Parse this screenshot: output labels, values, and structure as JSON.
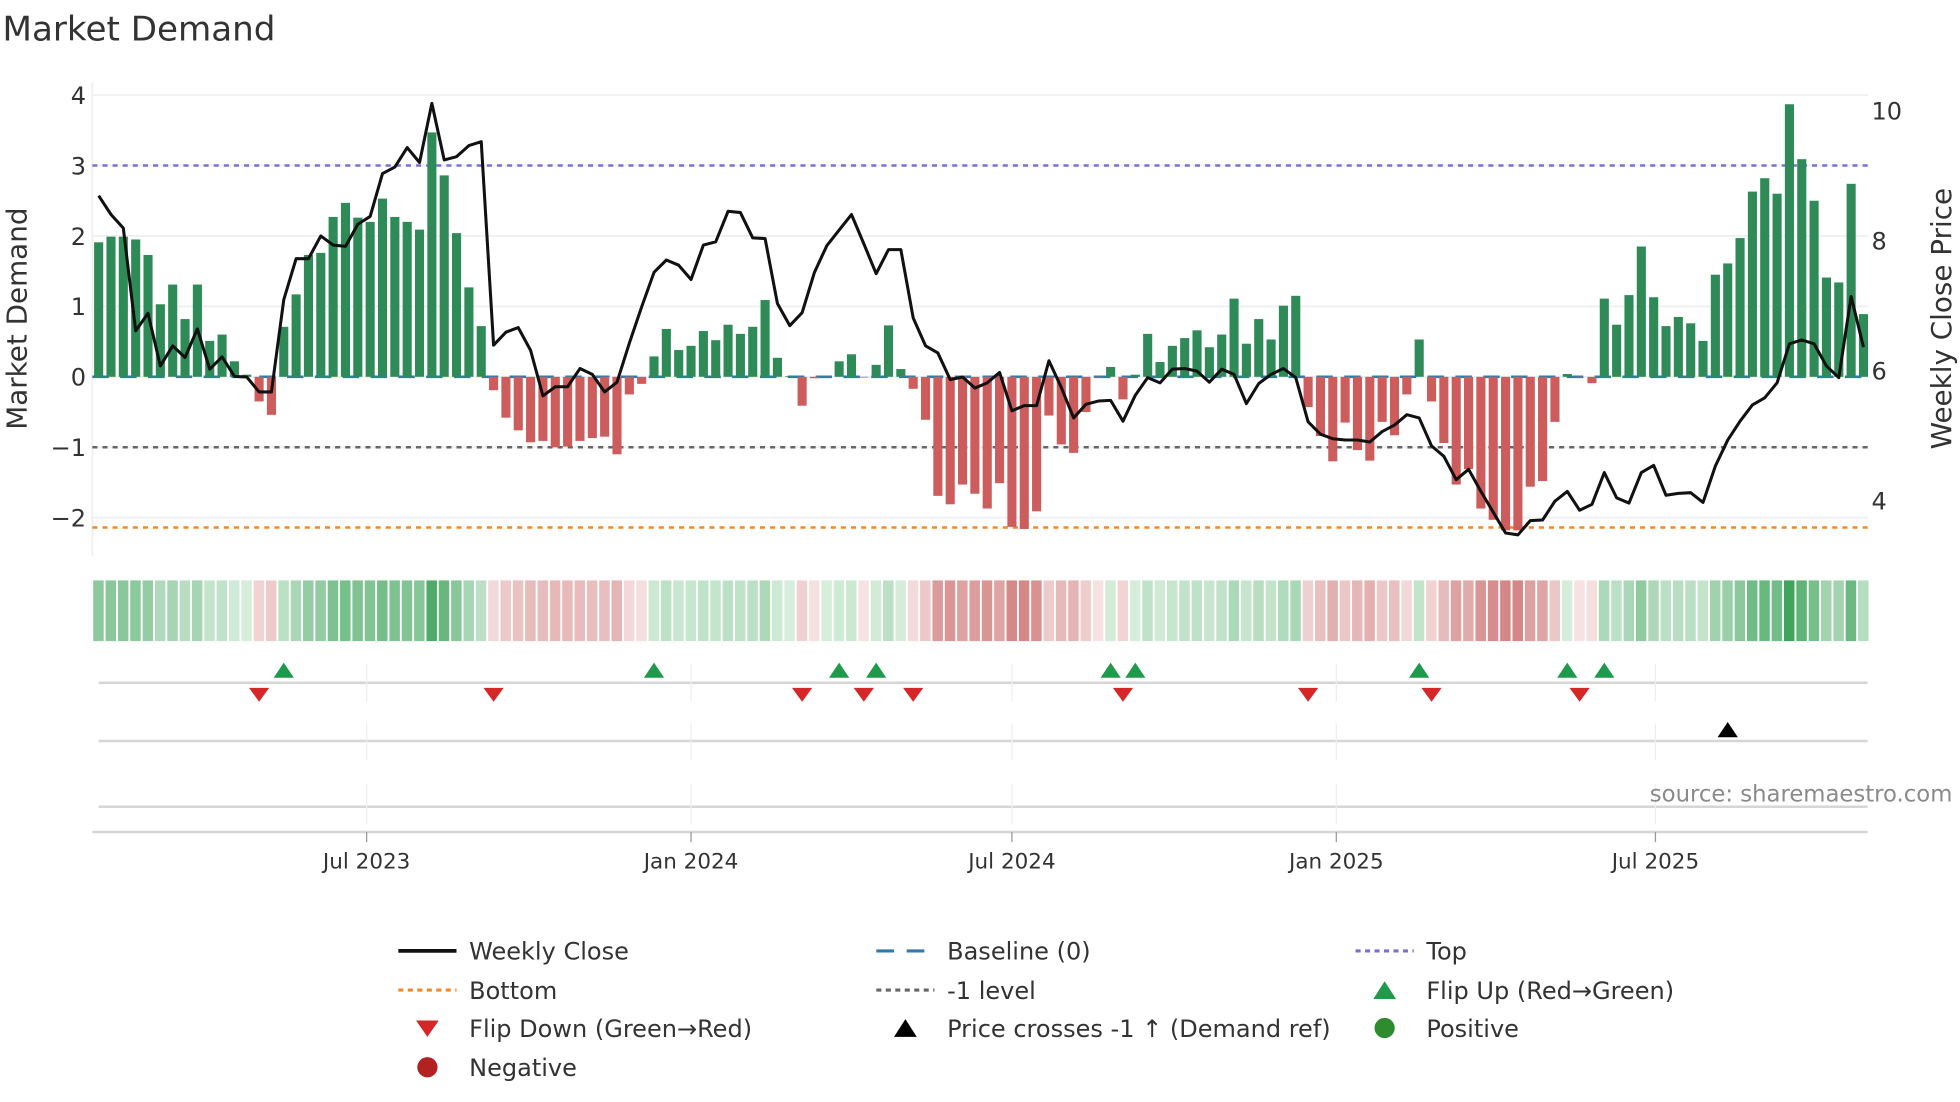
{
  "chart_data": {
    "type": "bar",
    "title": "Market Demand",
    "ylabel": "Market Demand",
    "y2label": "Weekly Close Price",
    "ylim": [
      -2.55,
      4.15
    ],
    "y2lim": [
      2.9,
      10.6
    ],
    "yticks": [
      4,
      3,
      2,
      1,
      0,
      -1,
      -2
    ],
    "ytick_labels": [
      "4",
      "3",
      "2",
      "1",
      "0",
      "−1",
      "−2"
    ],
    "y2ticks": [
      10,
      8,
      6,
      4
    ],
    "y2tick_labels": [
      "10",
      "8",
      "6",
      "4"
    ],
    "x_start": "2023-01-30",
    "x_freq": "weekly",
    "xticks": [
      {
        "date": "2023-07-01",
        "label": "Jul 2023"
      },
      {
        "date": "2024-01-01",
        "label": "Jan 2024"
      },
      {
        "date": "2024-07-01",
        "label": "Jul 2024"
      },
      {
        "date": "2025-01-01",
        "label": "Jan 2025"
      },
      {
        "date": "2025-07-01",
        "label": "Jul 2025"
      }
    ],
    "levels": {
      "top": 3.0,
      "baseline": 0,
      "minus_one": -1,
      "bottom": -2.14
    },
    "series": [
      {
        "name": "Market Demand",
        "kind": "bar",
        "values": [
          1.91,
          1.99,
          1.99,
          1.95,
          1.73,
          1.03,
          1.31,
          0.82,
          1.31,
          0.51,
          0.6,
          0.22,
          0.03,
          -0.35,
          -0.54,
          0.71,
          1.17,
          1.73,
          1.76,
          2.27,
          2.47,
          2.26,
          2.2,
          2.53,
          2.27,
          2.2,
          2.09,
          3.47,
          2.86,
          2.04,
          1.27,
          0.72,
          -0.19,
          -0.58,
          -0.76,
          -0.93,
          -0.91,
          -1.0,
          -0.99,
          -0.91,
          -0.87,
          -0.85,
          -1.1,
          -0.25,
          -0.1,
          0.29,
          0.68,
          0.38,
          0.44,
          0.65,
          0.52,
          0.74,
          0.61,
          0.71,
          1.09,
          0.27,
          0.01,
          -0.41,
          -0.02,
          0.0,
          0.22,
          0.32,
          -0.01,
          0.17,
          0.73,
          0.11,
          -0.17,
          -0.61,
          -1.69,
          -1.81,
          -1.53,
          -1.66,
          -1.87,
          -1.51,
          -2.13,
          -2.16,
          -1.91,
          -0.55,
          -0.96,
          -1.08,
          -0.5,
          -0.01,
          0.14,
          -0.32,
          0.03,
          0.61,
          0.21,
          0.44,
          0.55,
          0.66,
          0.42,
          0.6,
          1.11,
          0.47,
          0.82,
          0.53,
          1.01,
          1.15,
          -0.43,
          -0.84,
          -1.2,
          -0.65,
          -1.04,
          -1.19,
          -0.64,
          -0.83,
          -0.25,
          0.53,
          -0.35,
          -0.94,
          -1.53,
          -1.31,
          -1.87,
          -2.03,
          -2.18,
          -2.18,
          -1.56,
          -1.48,
          -0.64,
          0.04,
          -0.01,
          -0.09,
          1.11,
          0.74,
          1.16,
          1.85,
          1.13,
          0.72,
          0.85,
          0.76,
          0.51,
          1.45,
          1.61,
          1.97,
          2.63,
          2.82,
          2.6,
          3.87,
          3.09,
          2.5,
          1.41,
          1.34,
          2.74,
          0.89
        ]
      },
      {
        "name": "Weekly Close",
        "kind": "line",
        "axis": "right",
        "values": [
          8.69,
          8.4,
          8.19,
          6.61,
          6.88,
          6.07,
          6.38,
          6.2,
          6.64,
          6.02,
          6.21,
          5.91,
          5.9,
          5.67,
          5.67,
          7.09,
          7.72,
          7.72,
          8.07,
          7.93,
          7.91,
          8.25,
          8.37,
          9.03,
          9.13,
          9.43,
          9.2,
          10.11,
          9.24,
          9.29,
          9.46,
          9.52,
          6.39,
          6.59,
          6.66,
          6.31,
          5.61,
          5.75,
          5.75,
          6.03,
          5.94,
          5.67,
          5.82,
          6.42,
          6.98,
          7.51,
          7.7,
          7.62,
          7.4,
          7.93,
          7.98,
          8.45,
          8.43,
          8.04,
          8.03,
          7.03,
          6.69,
          6.89,
          7.51,
          7.92,
          8.16,
          8.4,
          7.95,
          7.49,
          7.86,
          7.86,
          6.81,
          6.38,
          6.27,
          5.86,
          5.9,
          5.73,
          5.81,
          5.97,
          5.38,
          5.46,
          5.46,
          6.15,
          5.74,
          5.27,
          5.48,
          5.53,
          5.54,
          5.22,
          5.62,
          5.89,
          5.81,
          6.02,
          6.03,
          5.99,
          5.82,
          6.02,
          5.94,
          5.49,
          5.8,
          5.94,
          6.03,
          5.89,
          5.21,
          5.02,
          4.95,
          4.93,
          4.93,
          4.9,
          5.06,
          5.16,
          5.32,
          5.27,
          4.84,
          4.68,
          4.32,
          4.48,
          4.14,
          3.82,
          3.5,
          3.47,
          3.69,
          3.7,
          3.99,
          4.14,
          3.85,
          3.94,
          4.43,
          4.04,
          3.96,
          4.43,
          4.54,
          4.08,
          4.11,
          4.12,
          3.97,
          4.53,
          4.93,
          5.22,
          5.47,
          5.58,
          5.81,
          6.41,
          6.47,
          6.41,
          6.07,
          5.89,
          7.14,
          6.36
        ]
      }
    ],
    "events": {
      "flip_up_weeks": [
        15,
        45,
        60,
        63,
        82,
        84,
        107,
        119,
        122
      ],
      "flip_down_weeks": [
        13,
        32,
        57,
        62,
        66,
        83,
        98,
        108,
        120
      ],
      "price_cross_weeks": [
        132
      ]
    },
    "legend": {
      "placement": "bottom",
      "items": [
        {
          "label": "Weekly Close",
          "symbol": "solid-line",
          "color": "#111111"
        },
        {
          "label": "Baseline (0)",
          "symbol": "dash-line",
          "color": "#2e7bb0"
        },
        {
          "label": "Top",
          "symbol": "dot-line",
          "color": "#7b6fd6"
        },
        {
          "label": "Bottom",
          "symbol": "dot-line",
          "color": "#f08a24"
        },
        {
          "label": "-1 level",
          "symbol": "dot-line",
          "color": "#666666"
        },
        {
          "label": "Flip Up (Red→Green)",
          "symbol": "triangle-up",
          "color": "#1e9a4a"
        },
        {
          "label": "Flip Down (Green→Red)",
          "symbol": "triangle-down",
          "color": "#d62728"
        },
        {
          "label": "Price crosses -1 ↑ (Demand ref)",
          "symbol": "triangle-up",
          "color": "#000000"
        },
        {
          "label": "Positive",
          "symbol": "circle",
          "color": "#2e8b2e"
        },
        {
          "label": "Negative",
          "symbol": "circle",
          "color": "#b22222"
        }
      ]
    },
    "source": "source: sharemaestro.com",
    "colors": {
      "positive": "#2e8b57",
      "negative": "#cd5c5c",
      "line": "#111111"
    }
  }
}
